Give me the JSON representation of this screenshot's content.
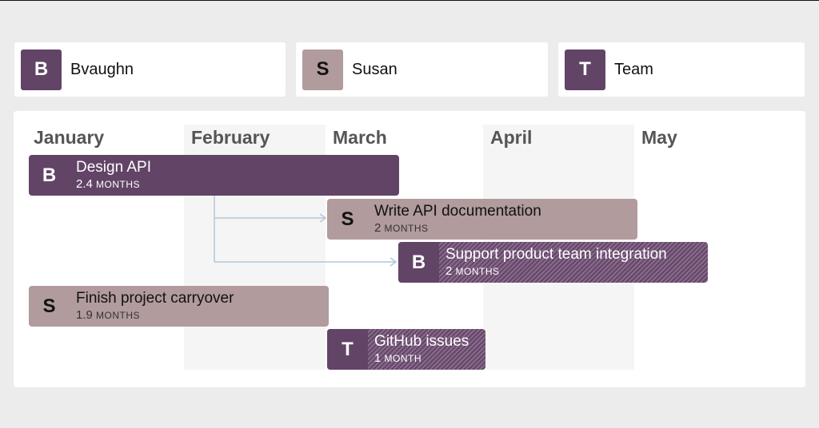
{
  "assignees": [
    {
      "initial": "B",
      "name": "Bvaughn",
      "color": "#624467",
      "text_color": "#ffffff"
    },
    {
      "initial": "S",
      "name": "Susan",
      "color": "#b19b9c",
      "text_color": "#111111"
    },
    {
      "initial": "T",
      "name": "Team",
      "color": "#624467",
      "text_color": "#ffffff"
    }
  ],
  "months": [
    "January",
    "February",
    "March",
    "April",
    "May"
  ],
  "tasks": [
    {
      "badge": "B",
      "title": "Design API",
      "duration": "2.4",
      "unit": "MONTHS"
    },
    {
      "badge": "S",
      "title": "Write API documentation",
      "duration": "2",
      "unit": "MONTHS"
    },
    {
      "badge": "B",
      "title": "Support product team integration",
      "duration": "2",
      "unit": "MONTHS"
    },
    {
      "badge": "S",
      "title": "Finish project carryover",
      "duration": "1.9",
      "unit": "MONTHS"
    },
    {
      "badge": "T",
      "title": "GitHub issues",
      "duration": "1",
      "unit": "MONTH"
    }
  ],
  "colors": {
    "bvaughn": "#624467",
    "susan": "#b19b9c",
    "team": "#624467",
    "dependency_line": "#b3c6d8"
  }
}
